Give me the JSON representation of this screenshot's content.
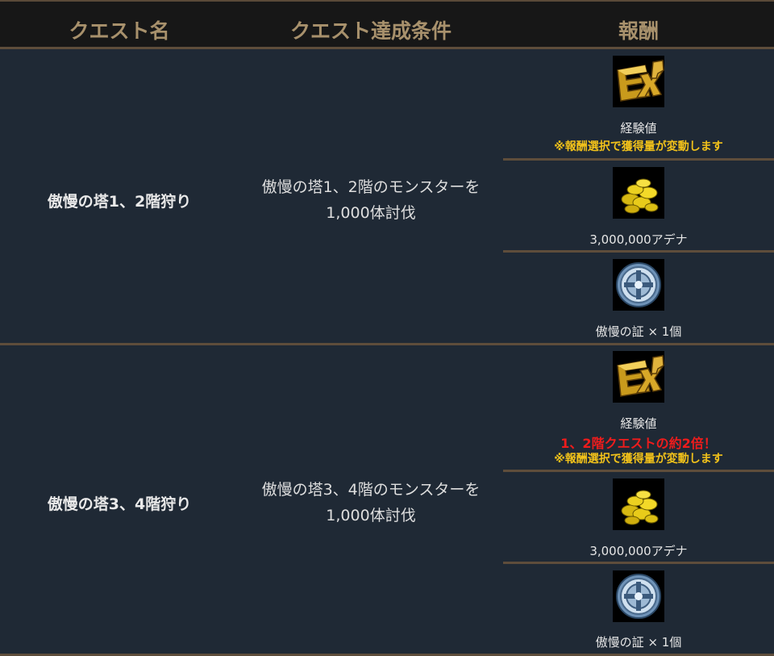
{
  "header": {
    "col1": "クエスト名",
    "col2": "クエスト達成条件",
    "col3": "報酬"
  },
  "quests": [
    {
      "name": "傲慢の塔1、2階狩り",
      "condition_line1": "傲慢の塔1、2階のモンスターを",
      "condition_line2": "1,000体討伐",
      "rewards": [
        {
          "icon": "exp-icon",
          "label": "経験値",
          "note": "※報酬選択で獲得量が変動します"
        },
        {
          "icon": "adena-coins-icon",
          "label": "3,000,000アデナ"
        },
        {
          "icon": "proof-of-arrogance-icon",
          "label": "傲慢の証 × 1個"
        }
      ]
    },
    {
      "name": "傲慢の塔3、4階狩り",
      "condition_line1": "傲慢の塔3、4階のモンスターを",
      "condition_line2": "1,000体討伐",
      "rewards": [
        {
          "icon": "exp-icon",
          "label": "経験値",
          "bonus": "1、2階クエストの約2倍！",
          "note": "※報酬選択で獲得量が変動します"
        },
        {
          "icon": "adena-coins-icon",
          "label": "3,000,000アデナ"
        },
        {
          "icon": "proof-of-arrogance-icon",
          "label": "傲慢の証 × 1個"
        }
      ]
    }
  ],
  "colors": {
    "background": "#1f2935",
    "header_bg": "#171717",
    "header_text": "#a8916c",
    "divider": "#5e4d3b",
    "note": "#f2c21a",
    "bonus": "#ee1c1c"
  }
}
